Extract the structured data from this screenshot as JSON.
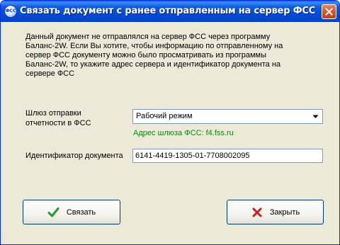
{
  "window": {
    "title": "Связать документ с ранее отправленным на сервер ФСС",
    "icon": "fss-app-icon",
    "icon_text": "ФСС"
  },
  "description": "Данный документ не отправлялся на сервер ФСС через программу Баланс-2W. Если Вы хотите, чтобы информацию по отправленному на сервер ФСС документу можно было просматривать из программы Баланс-2W, то укажите адрес сервера и идентификатор документа на сервере ФСС",
  "gateway": {
    "label_line1": "Шлюз отправки",
    "label_line2": "отчетности в ФСС",
    "selected": "Рабочий режим",
    "address_text": "Адрес шлюза ФСС: f4.fss.ru",
    "address_color": "#0a8a0a"
  },
  "document_id": {
    "label": "Идентификатор документа",
    "value": "6141-4419-1305-01-7708002095"
  },
  "buttons": {
    "link_label": "Связать",
    "link_icon": "checkmark-icon",
    "close_label": "Закрыть",
    "close_icon": "red-x-icon"
  }
}
